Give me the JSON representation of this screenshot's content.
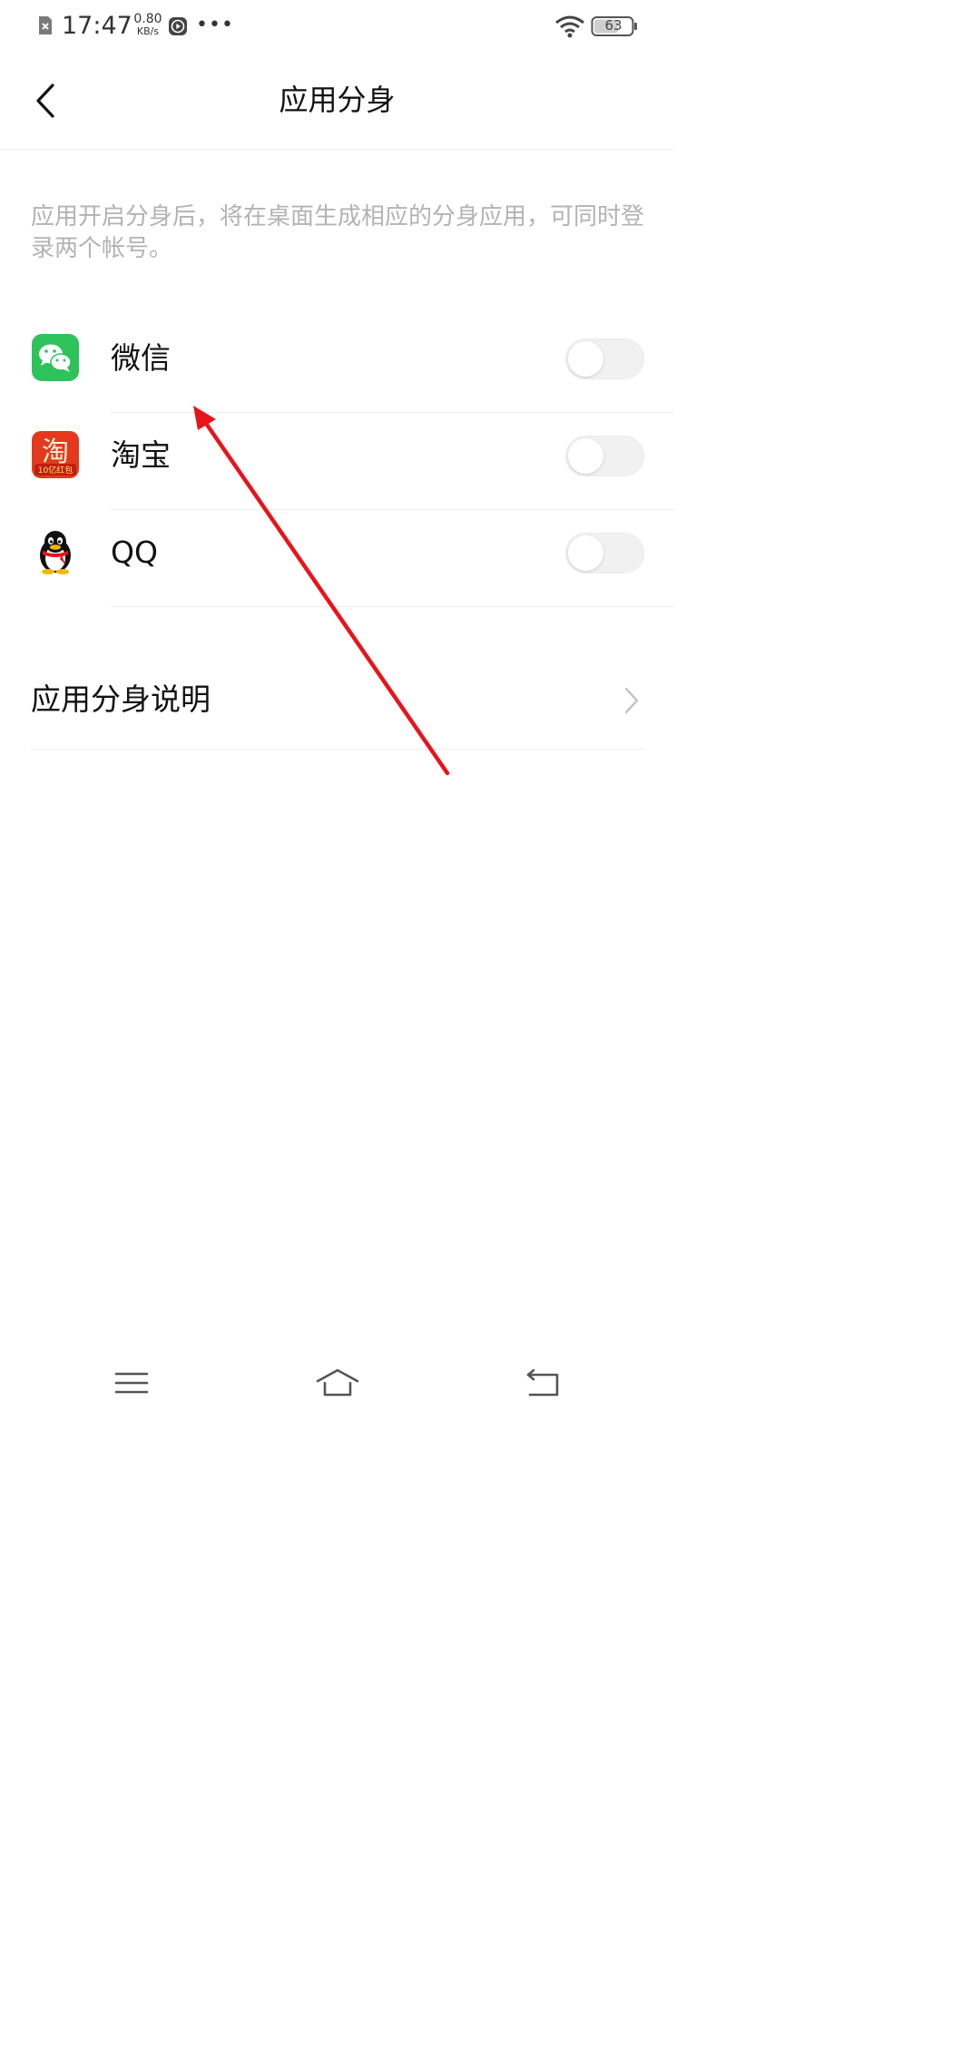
{
  "status_bar": {
    "time": "17:47",
    "net_speed_value": "0.80",
    "net_speed_unit": "KB/s",
    "more": "•••",
    "battery": "63",
    "icons": [
      "sim-off-icon",
      "media-play-icon",
      "wifi-icon",
      "battery-icon"
    ]
  },
  "header": {
    "title": "应用分身",
    "back_icon": "back-arrow-icon"
  },
  "description": "应用开启分身后，将在桌面生成相应的分身应用，可同时登录两个帐号。",
  "apps": [
    {
      "name": "微信",
      "icon": "wechat-icon",
      "enabled": false
    },
    {
      "name": "淘宝",
      "icon": "taobao-icon",
      "icon_text": "淘",
      "icon_subtext": "10亿红包",
      "enabled": false
    },
    {
      "name": "QQ",
      "icon": "qq-penguin-icon",
      "enabled": false
    }
  ],
  "explain": {
    "label": "应用分身说明",
    "icon": "chevron-right-icon"
  },
  "annotation": {
    "type": "red-arrow",
    "color": "#e8141b"
  },
  "nav_bar": {
    "icons": [
      "menu-icon",
      "home-icon",
      "back-icon"
    ]
  },
  "colors": {
    "wechat_green": "#2dc25a",
    "taobao_red": "#e33a1e",
    "toggle_off": "#f1f1f1",
    "desc_text": "#b3b3b3"
  }
}
